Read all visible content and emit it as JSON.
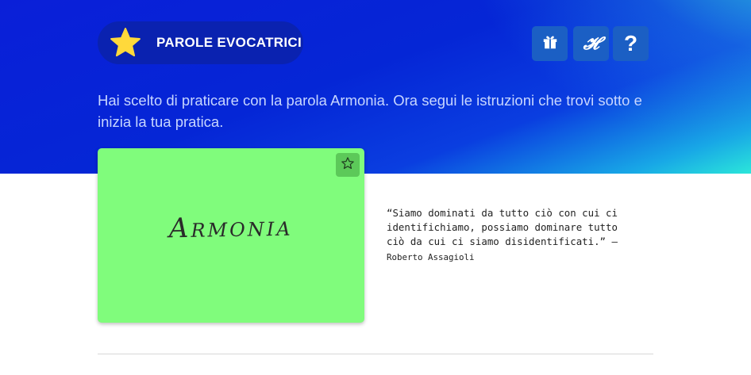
{
  "header": {
    "badge_label": "PAROLE EVOCATRICI",
    "badge_icon": "star-icon",
    "buttons": [
      {
        "name": "gift-icon"
      },
      {
        "name": "h-logo",
        "label": "𝓗"
      },
      {
        "name": "help",
        "label": "?"
      }
    ]
  },
  "intro": {
    "text": "Hai scelto di praticare con la parola Armonia. Ora segui le istruzioni che trovi sotto e inizia la tua pratica."
  },
  "card": {
    "word": "Armonia",
    "color": "#80fc7c",
    "favorite_icon": "star-outline-icon"
  },
  "quote": {
    "text": "“Siamo dominati da tutto ciò con cui ci identifichiamo, possiamo dominare tutto ciò da cui ci siamo disidentificati.” —",
    "author": "Roberto Assagioli"
  },
  "colors": {
    "hero_start": "#0a1fd8",
    "hero_end": "#2be6da",
    "star": "#ffd93b"
  }
}
